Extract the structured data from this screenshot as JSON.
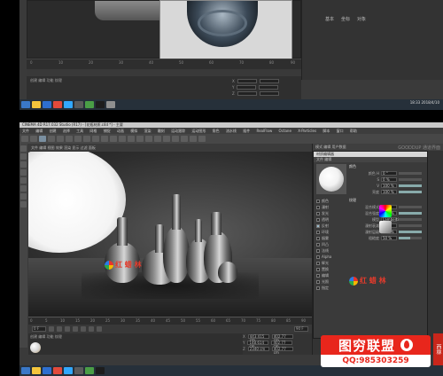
{
  "top": {
    "image_status": "Ctrl 2560x1600 2559 x 1419 Mem 60% 30:00 | 360x360  Fn",
    "attr_tabs": [
      "基本",
      "坐标",
      "对象"
    ],
    "timeline_ticks": [
      "0",
      "10",
      "20",
      "30",
      "40",
      "50",
      "60",
      "70",
      "80",
      "90"
    ],
    "material_menu": "创建  编辑  功能  纹理",
    "coords": [
      "X",
      "Y",
      "Z"
    ],
    "taskbar_clock": "18:33 2018/4/10"
  },
  "app": {
    "title": "CINEMA 4D R17.032 Studio (R17) - [花瓶材质.c4d *] - 主要",
    "menus": [
      "文件",
      "编辑",
      "创建",
      "选择",
      "工具",
      "网格",
      "捕捉",
      "动画",
      "模拟",
      "渲染",
      "雕刻",
      "运动跟踪",
      "运动图形",
      "角色",
      "流水线",
      "插件",
      "RealFlow",
      "Octane",
      "X-Particles",
      "脚本",
      "窗口",
      "帮助"
    ],
    "render_menu": "文件  编辑  视图  效果  渲染  显示  过滤  面板",
    "layout_label": "界面: 启动"
  },
  "timeline": {
    "ticks": [
      "0",
      "5",
      "10",
      "15",
      "20",
      "25",
      "30",
      "35",
      "40",
      "45",
      "50",
      "55",
      "60",
      "65",
      "70",
      "75",
      "80",
      "85",
      "90"
    ],
    "frame_start": "0 F",
    "frame_end": "90 F"
  },
  "material_manager": {
    "menu": "创建  编辑  功能  纹理",
    "material_name": "材质"
  },
  "coords": {
    "rows": [
      {
        "axis": "X",
        "pos": "443.415 cm",
        "size": "402.77 cm"
      },
      {
        "axis": "Y",
        "pos": "148.614 cm",
        "size": "402.77 cm"
      },
      {
        "axis": "Z",
        "pos": "2340 cm",
        "size": "402.77 cm"
      }
    ]
  },
  "right_panel": {
    "header": "模式  编辑  用户数据",
    "logo": "GOODDUP 通道界面"
  },
  "mat_editor": {
    "title": "材质编辑器",
    "menu": "文件 编辑",
    "channels": [
      {
        "label": "颜色",
        "on": false
      },
      {
        "label": "漫射",
        "on": false
      },
      {
        "label": "发光",
        "on": false
      },
      {
        "label": "透明",
        "on": false
      },
      {
        "label": "反射",
        "on": true
      },
      {
        "label": "环境",
        "on": false
      },
      {
        "label": "烟雾",
        "on": false
      },
      {
        "label": "凹凸",
        "on": false
      },
      {
        "label": "法线",
        "on": false
      },
      {
        "label": "Alpha",
        "on": false
      },
      {
        "label": "辉光",
        "on": false
      },
      {
        "label": "置换",
        "on": false
      },
      {
        "label": "编辑",
        "on": false
      },
      {
        "label": "光照",
        "on": false
      },
      {
        "label": "指定",
        "on": false
      }
    ],
    "section1": "颜色",
    "section2": "纹理",
    "props": [
      {
        "label": "颜色 H",
        "value": "0 °",
        "fill": 0.0
      },
      {
        "label": "S",
        "value": "0 %",
        "fill": 0.0
      },
      {
        "label": "V",
        "value": "100 %",
        "fill": 1.0
      },
      {
        "label": "亮度",
        "value": "100 %",
        "fill": 1.0
      }
    ],
    "props2": [
      {
        "label": "混合模式",
        "value": "标准",
        "fill": 0.0
      },
      {
        "label": "混合强度",
        "value": "100 %",
        "fill": 1.0
      },
      {
        "label": "模型",
        "value": "Lambertian",
        "fill": 0.0
      },
      {
        "label": "漫射衰减",
        "value": "0 %",
        "fill": 0.0
      },
      {
        "label": "漫射层级",
        "value": "100 %",
        "fill": 1.0
      },
      {
        "label": "粗糙度",
        "value": "50 %",
        "fill": 0.5
      }
    ]
  },
  "watermark": {
    "viewport_logo": "红 蜡 林",
    "banner_title": "图穷联盟",
    "banner_qq": "QQ:985303259",
    "side_tag": "西林"
  }
}
